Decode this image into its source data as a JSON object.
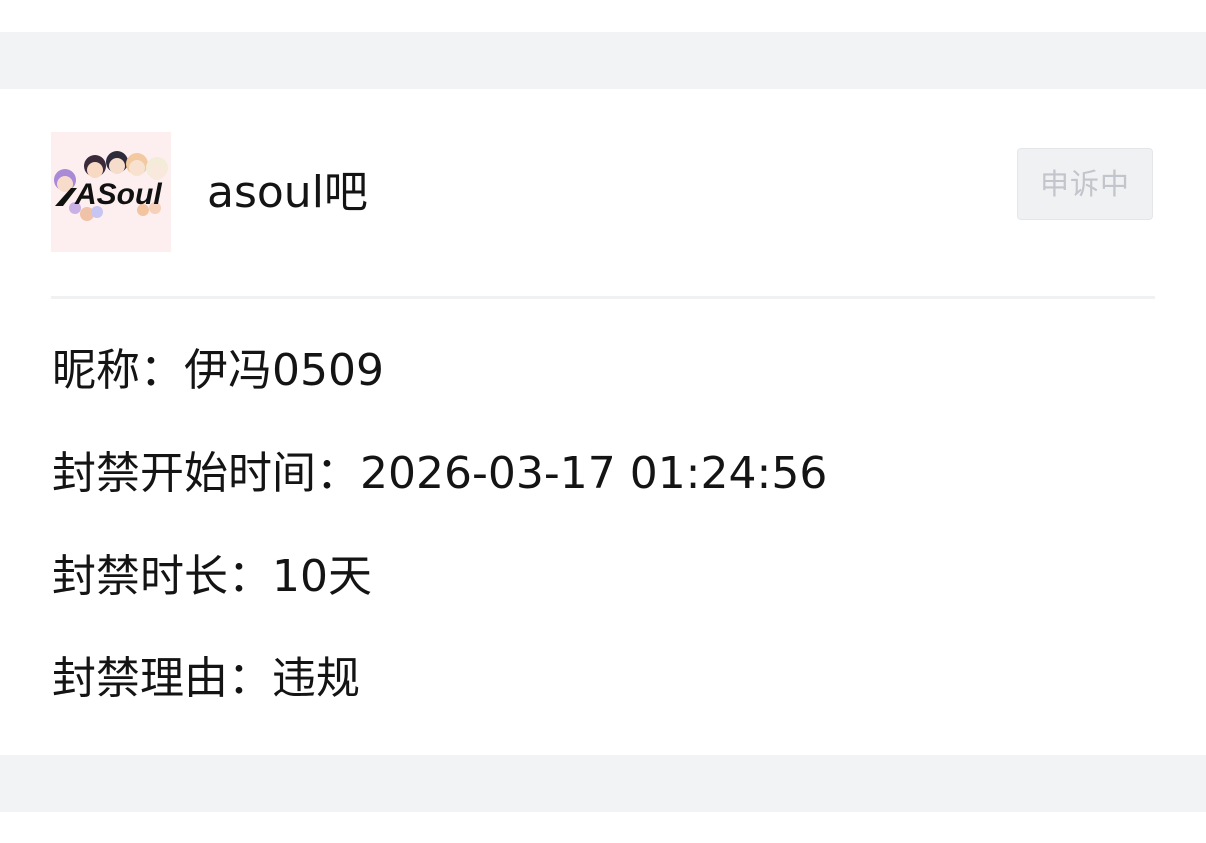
{
  "forum": {
    "name": "asoul吧",
    "avatar_text": "ASoul",
    "avatar_icon": "asoul-logo"
  },
  "appeal_button": {
    "label": "申诉中",
    "state": "disabled"
  },
  "details": {
    "nickname": {
      "label": "昵称：",
      "value": "伊冯0509"
    },
    "ban_start": {
      "label": "封禁开始时间：",
      "value": "2026-03-17 01:24:56"
    },
    "ban_duration": {
      "label": "封禁时长：",
      "value": "10天"
    },
    "ban_reason": {
      "label": "封禁理由：",
      "value": "违规"
    }
  },
  "colors": {
    "background_band": "#f2f3f5",
    "text": "#141414",
    "button_bg": "#f0f1f3",
    "button_text": "#c2c5cb"
  }
}
